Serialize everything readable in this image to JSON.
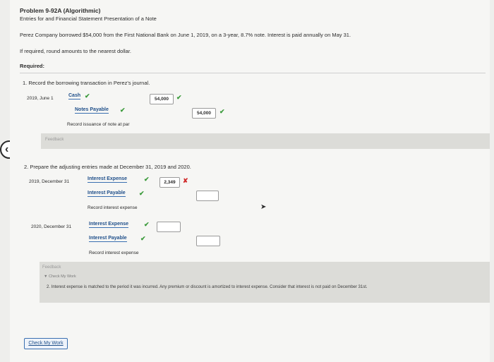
{
  "problem": {
    "title": "Problem 9-92A (Algorithmic)",
    "subtitle": "Entries for and Financial Statement Presentation of a Note",
    "description": "Perez Company borrowed $54,000 from the First National Bank on June 1, 2019, on a 3-year, 8.7% note. Interest is paid annually on May 31.",
    "rounding_note": "If required, round amounts to the nearest dollar.",
    "required_label": "Required:"
  },
  "part1": {
    "instruction": "1.  Record the borrowing transaction in Perez's journal.",
    "date": "2019, June 1",
    "debit_account": "Cash",
    "debit_amount": "54,000",
    "credit_account": "Notes Payable",
    "credit_amount": "54,000",
    "memo": "Record issuance of note at par",
    "feedback_label": "Feedback"
  },
  "part2": {
    "instruction": "2.  Prepare the adjusting entries made at December 31, 2019 and 2020.",
    "entry1": {
      "date": "2019, December 31",
      "debit_account": "Interest Expense",
      "debit_amount": "2,349",
      "credit_account": "Interest Payable",
      "credit_amount": "",
      "memo": "Record interest expense"
    },
    "entry2": {
      "date": "2020, December 31",
      "debit_account": "Interest Expense",
      "debit_amount": "",
      "credit_account": "Interest Payable",
      "credit_amount": "",
      "memo": "Record interest expense"
    },
    "feedback_label": "Feedback",
    "check_my_work_label": "Check My Work",
    "feedback_text": "2. Interest expense is matched to the period it was incurred. Any premium or discount is amortized to interest expense. Consider that interest is not paid on December 31st."
  },
  "footer": {
    "check_button_label": "Check My Work"
  },
  "colors": {
    "check_green": "#3a9a3a",
    "error_red": "#d02a2a",
    "link_blue": "#1f4f8a"
  }
}
